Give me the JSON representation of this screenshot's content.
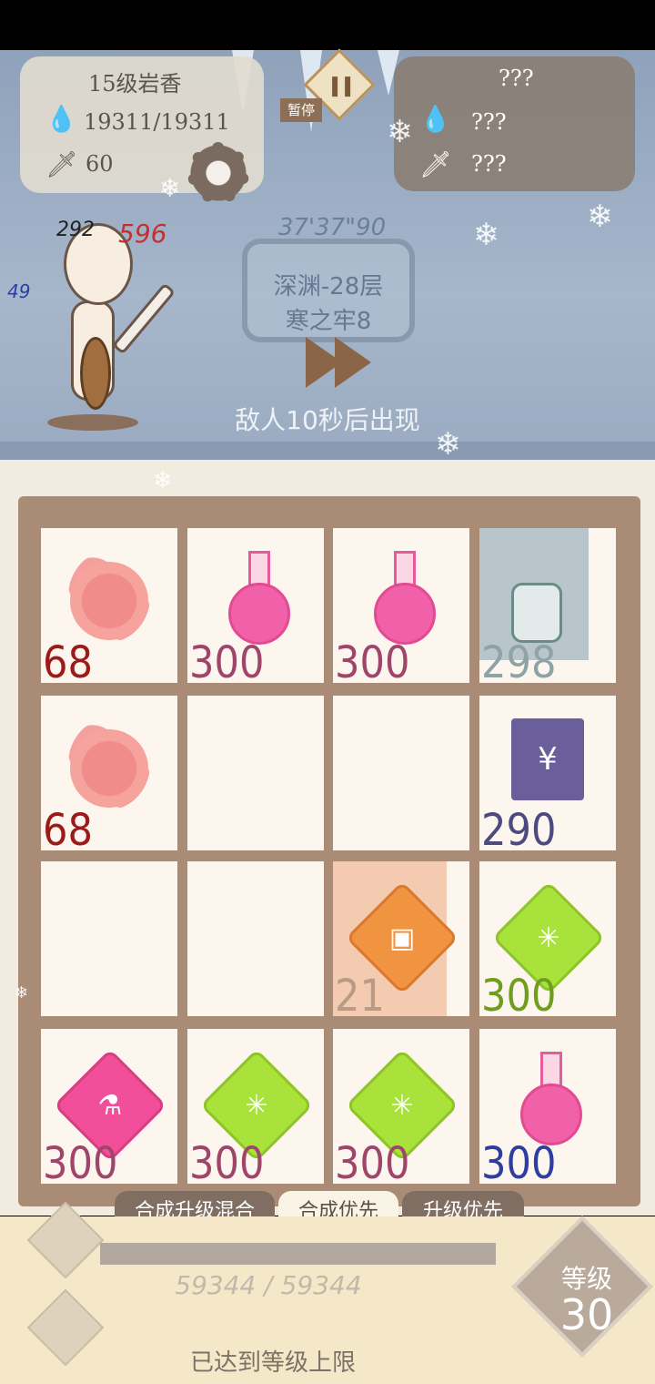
{
  "player": {
    "name": "15级岩香",
    "hp": "19311/19311",
    "attack": "60"
  },
  "enemy": {
    "name": "???",
    "hp": "???",
    "attack": "???"
  },
  "pause_label": "暂停",
  "timer": "37'37\"90",
  "floor": {
    "line1": "深渊-28层",
    "line2": "寒之牢8"
  },
  "announce": "敌人10秒后出现",
  "damage": {
    "shield": "292",
    "hit": "596",
    "blue": "49"
  },
  "grid": [
    {
      "item": "poison-cloud",
      "value": "68",
      "color": "#9b1a1a"
    },
    {
      "item": "pink-potion",
      "value": "300",
      "color": "#a0456a"
    },
    {
      "item": "pink-potion",
      "value": "300",
      "color": "#a0456a"
    },
    {
      "item": "arrow-quiver",
      "value": "298",
      "color": "#8fa2a4"
    },
    {
      "item": "poison-cloud",
      "value": "68",
      "color": "#9b1a1a"
    },
    {
      "item": "empty",
      "value": ""
    },
    {
      "item": "empty",
      "value": ""
    },
    {
      "item": "yen-document",
      "value": "290",
      "color": "#4d4a80"
    },
    {
      "item": "empty",
      "value": ""
    },
    {
      "item": "empty",
      "value": ""
    },
    {
      "item": "orange-gem",
      "value": "21",
      "color": "#b89a86"
    },
    {
      "item": "green-gem",
      "value": "300",
      "color": "#6f9d1d"
    },
    {
      "item": "pink-gem",
      "value": "300",
      "color": "#a0456a"
    },
    {
      "item": "green-gem",
      "value": "300",
      "color": "#a0456a"
    },
    {
      "item": "green-gem",
      "value": "300",
      "color": "#a0456a"
    },
    {
      "item": "pink-potion",
      "value": "300",
      "color": "#2d3ea0"
    }
  ],
  "tabs": [
    "合成升级混合",
    "合成优先",
    "升级优先"
  ],
  "xp": "59344 / 59344",
  "level_label": "等级",
  "level": "30",
  "max_level_text": "已达到等级上限"
}
